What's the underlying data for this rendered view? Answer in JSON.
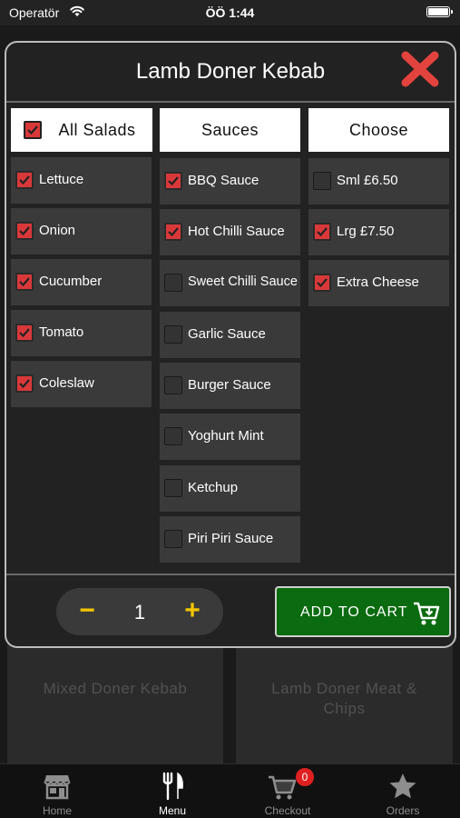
{
  "status_bar": {
    "carrier": "Operatör",
    "time": "ÖÖ 1:44"
  },
  "background_menu": {
    "items": [
      {
        "label": "Mixed Doner Kebab"
      },
      {
        "label": "Lamb Doner Meat & Chips"
      }
    ]
  },
  "modal": {
    "title": "Lamb Doner Kebab",
    "columns": [
      {
        "header": "All Salads",
        "header_checked": true,
        "options": [
          {
            "label": "Lettuce",
            "checked": true
          },
          {
            "label": "Onion",
            "checked": true
          },
          {
            "label": "Cucumber",
            "checked": true
          },
          {
            "label": "Tomato",
            "checked": true
          },
          {
            "label": "Coleslaw",
            "checked": true
          }
        ]
      },
      {
        "header": "Sauces",
        "options": [
          {
            "label": "BBQ Sauce",
            "checked": true
          },
          {
            "label": "Hot Chilli Sauce",
            "checked": true
          },
          {
            "label": "Sweet Chilli Sauce",
            "checked": false
          },
          {
            "label": "Garlic Sauce",
            "checked": false
          },
          {
            "label": "Burger Sauce",
            "checked": false
          },
          {
            "label": "Yoghurt Mint",
            "checked": false
          },
          {
            "label": "Ketchup",
            "checked": false
          },
          {
            "label": "Piri Piri Sauce",
            "checked": false
          }
        ]
      },
      {
        "header": "Choose",
        "options": [
          {
            "label": "Sml £6.50",
            "checked": false
          },
          {
            "label": "Lrg £7.50",
            "checked": true
          },
          {
            "label": "Extra Cheese",
            "checked": true
          }
        ]
      }
    ],
    "quantity": {
      "value": "1",
      "minus_label": "−",
      "plus_label": "+"
    },
    "add_to_cart_label": "ADD TO CART"
  },
  "tabbar": {
    "tabs": [
      {
        "label": "Home",
        "icon": "store-icon",
        "active": false
      },
      {
        "label": "Menu",
        "icon": "fork-knife-icon",
        "active": true
      },
      {
        "label": "Checkout",
        "icon": "cart-icon",
        "active": false,
        "badge": "0"
      },
      {
        "label": "Orders",
        "icon": "star-icon",
        "active": false
      }
    ]
  },
  "colors": {
    "accent_red": "#d9383a",
    "cart_green": "#0b6b10",
    "stepper_yellow": "#f2c500",
    "badge_red": "#e02020"
  }
}
